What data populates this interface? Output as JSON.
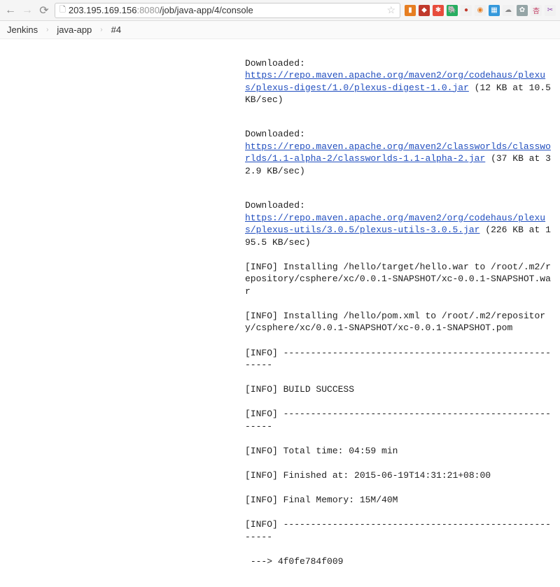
{
  "browser": {
    "url_host": "203.195.169.156",
    "url_port": ":8080",
    "url_path": "/job/java-app/4/console"
  },
  "breadcrumb": {
    "items": [
      "Jenkins",
      "java-app",
      "#4"
    ]
  },
  "console": {
    "blocks": [
      {
        "pre": "Downloaded: ",
        "link": "https://repo.maven.apache.org/maven2/org/codehaus/plexus/plexus-digest/1.0/plexus-digest-1.0.jar",
        "post": " (12 KB at 10.5 KB/sec)"
      },
      {
        "pre": "Downloaded: ",
        "link": "https://repo.maven.apache.org/maven2/classworlds/classworlds/1.1-alpha-2/classworlds-1.1-alpha-2.jar",
        "post": " (37 KB at 32.9 KB/sec)"
      },
      {
        "pre": "Downloaded: ",
        "link": "https://repo.maven.apache.org/maven2/org/codehaus/plexus/plexus-utils/3.0.5/plexus-utils-3.0.5.jar",
        "post": " (226 KB at 195.5 KB/sec)"
      }
    ],
    "info_lines": [
      "[INFO] Installing /hello/target/hello.war to /root/.m2/repository/csphere/xc/0.0.1-SNAPSHOT/xc-0.0.1-SNAPSHOT.war",
      "[INFO] Installing /hello/pom.xml to /root/.m2/repository/csphere/xc/0.0.1-SNAPSHOT/xc-0.0.1-SNAPSHOT.pom",
      "[INFO] ------------------------------------------------------",
      "[INFO] BUILD SUCCESS",
      "[INFO] ------------------------------------------------------",
      "[INFO] Total time: 04:59 min",
      "[INFO] Finished at: 2015-06-19T14:31:21+08:00",
      "[INFO] Final Memory: 15M/40M",
      "[INFO] ------------------------------------------------------"
    ],
    "final_line": " ---> 4f0fe784f009"
  }
}
